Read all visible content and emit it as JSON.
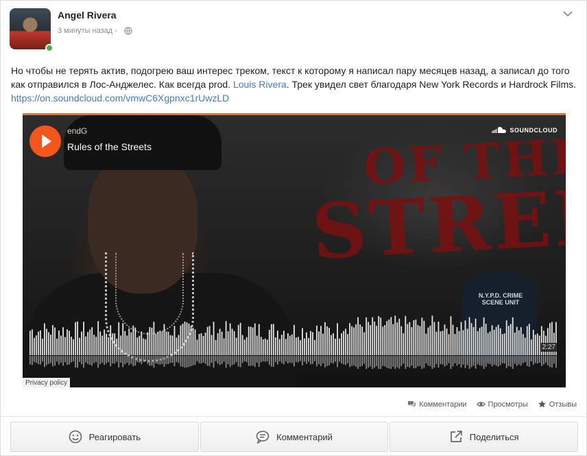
{
  "post": {
    "author": "Angel Rivera",
    "time": "3 минуты назад -",
    "text_part1": "Но чтобы не терять актив, подогрею ваш интерес треком, текст к которому я написал пару месяцев назад, а записал до того как отправился в Лос-Анджелес. Как всегда prod. ",
    "text_link": "Louis Rivera",
    "text_part2": ". Трек увидел свет благодаря New York Records и Hardrock Films.",
    "url": "https://on.soundcloud.com/vmwC6Xgpnxc1rUwzLD"
  },
  "player": {
    "artist": "endG",
    "track": "Rules of the Streets",
    "brand": "SOUNDCLOUD",
    "duration": "2:27",
    "privacy": "Privacy policy",
    "accent": "#f2561d",
    "artwork_text_top": "OF THE",
    "artwork_text_main": "STREETS",
    "artwork_badge": "N.Y.P.D. CRIME SCENE UNIT"
  },
  "stats": {
    "comments": "Комментарии",
    "views": "Просмотры",
    "reviews": "Отзывы"
  },
  "actions": {
    "react": "Реагировать",
    "comment": "Комментарий",
    "share": "Поделиться"
  }
}
